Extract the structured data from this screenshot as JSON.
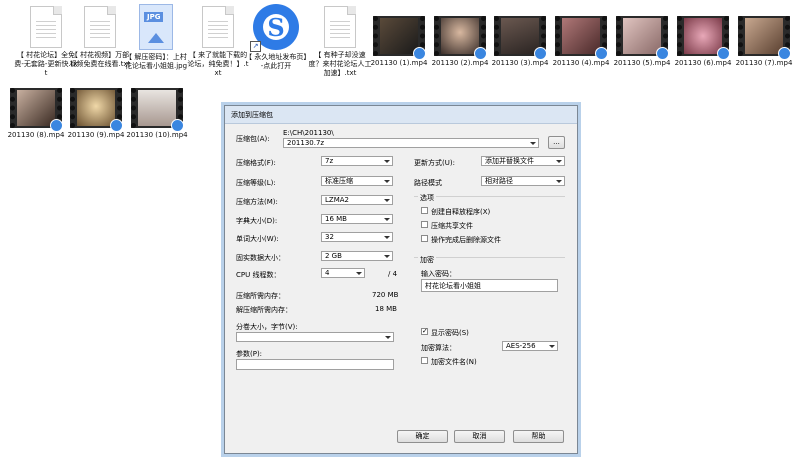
{
  "files": [
    {
      "kind": "txt",
      "label": "【 村花论坛】全免费-无套路-更新快.txt"
    },
    {
      "kind": "txt",
      "label": "【 村花视频】万部视频免费在线看.txt"
    },
    {
      "kind": "jpg",
      "label": "【 解压密码】：上村花论坛看小姐姐.jpg",
      "badge": "JPG"
    },
    {
      "kind": "txt",
      "label": "【 来了就能下载的论坛，纯免费！】.txt"
    },
    {
      "kind": "sogou",
      "label": "【 永久地址发布页】-点此打开",
      "badge": "S"
    },
    {
      "kind": "txt",
      "label": "【 有种子却没速度？来村花论坛人工加速】.txt"
    },
    {
      "kind": "mp4",
      "label": "201130 (1).mp4"
    },
    {
      "kind": "mp4",
      "label": "201130 (2).mp4"
    },
    {
      "kind": "mp4",
      "label": "201130 (3).mp4"
    },
    {
      "kind": "mp4",
      "label": "201130 (4).mp4"
    },
    {
      "kind": "mp4",
      "label": "201130 (5).mp4"
    },
    {
      "kind": "mp4",
      "label": "201130 (6).mp4"
    },
    {
      "kind": "mp4",
      "label": "201130 (7).mp4"
    },
    {
      "kind": "mp4",
      "label": "201130 (8).mp4"
    },
    {
      "kind": "mp4",
      "label": "201130 (9).mp4"
    },
    {
      "kind": "mp4",
      "label": "201130 (10).mp4"
    }
  ],
  "dialog": {
    "title": "添加到压缩包",
    "archive_label": "压缩包(A):",
    "archive_path": "E:\\CH\\201130\\",
    "archive_name": "201130.7z",
    "browse_label": "...",
    "format_label": "压缩格式(F):",
    "format_value": "7z",
    "level_label": "压缩等级(L):",
    "level_value": "标准压缩",
    "method_label": "压缩方法(M):",
    "method_value": "LZMA2",
    "dict_label": "字典大小(D):",
    "dict_value": "16 MB",
    "word_label": "单词大小(W):",
    "word_value": "32",
    "solid_label": "固实数据大小：",
    "solid_value": "2 GB",
    "threads_label": "CPU 线程数：",
    "threads_value": "4",
    "threads_max": "/ 4",
    "mem_comp_label": "压缩所需内存：",
    "mem_comp_value": "720 MB",
    "mem_decomp_label": "解压缩所需内存：",
    "mem_decomp_value": "18 MB",
    "split_label": "分卷大小，字节(V):",
    "split_value": "",
    "params_label": "参数(P):",
    "params_value": "",
    "update_label": "更新方式(U):",
    "update_value": "添加并替换文件",
    "pathmode_label": "路径模式",
    "pathmode_value": "相对路径",
    "options_title": "选项",
    "opt_sfx": "创建自释放程序(X)",
    "opt_shared": "压缩共享文件",
    "opt_delete": "操作完成后删除源文件",
    "encrypt_title": "加密",
    "pwd_label": "输入密码：",
    "pwd_value": "村花论坛看小姐姐",
    "show_pwd": "显示密码(S)",
    "enc_method_label": "加密算法：",
    "enc_method_value": "AES-256",
    "enc_names": "加密文件名(N)",
    "ok_label": "确定",
    "cancel_label": "取消",
    "help_label": "帮助"
  }
}
